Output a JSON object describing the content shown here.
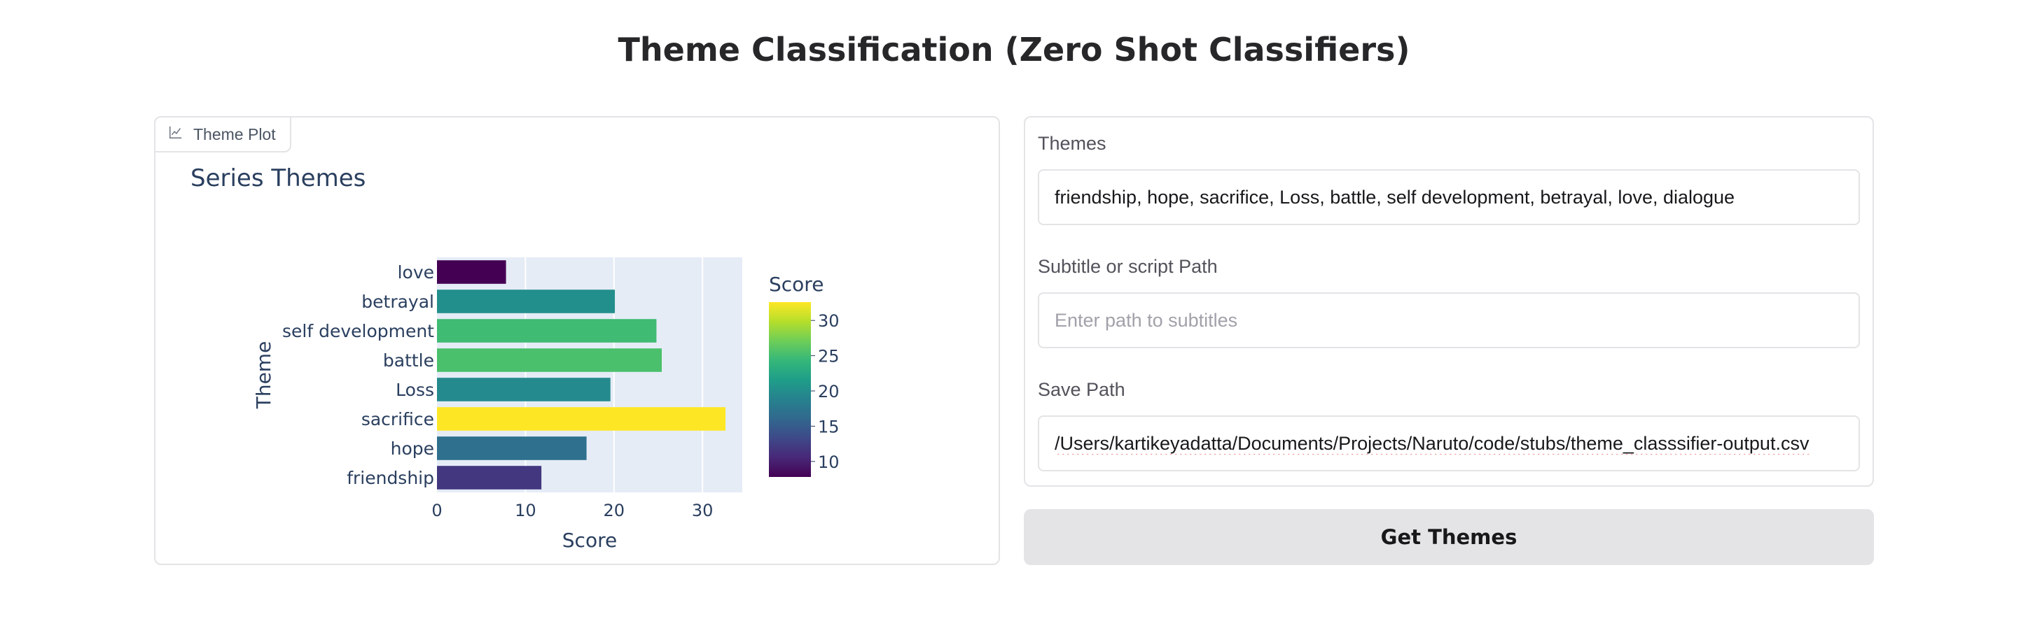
{
  "page": {
    "title": "Theme Classification (Zero Shot Classifiers)"
  },
  "plot_panel": {
    "label": "Theme Plot",
    "icon": "chart-icon"
  },
  "form": {
    "themes": {
      "label": "Themes",
      "value": "friendship, hope, sacrifice, Loss, battle, self development, betrayal, love, dialogue"
    },
    "subtitle_path": {
      "label": "Subtitle or script Path",
      "value": "",
      "placeholder": "Enter path to subtitles"
    },
    "save_path": {
      "label": "Save Path",
      "value": "/Users/kartikeyadatta/Documents/Projects/Naruto/code/stubs/theme_classsifier-output.csv"
    },
    "submit_label": "Get Themes"
  },
  "chart_data": {
    "type": "bar",
    "orientation": "horizontal",
    "title": "Series Themes",
    "xlabel": "Score",
    "ylabel": "Theme",
    "categories": [
      "friendship",
      "hope",
      "sacrifice",
      "Loss",
      "battle",
      "self development",
      "betrayal",
      "love"
    ],
    "values": [
      11.8,
      16.9,
      32.6,
      19.6,
      25.4,
      24.8,
      20.1,
      7.8
    ],
    "xlim": [
      0,
      34.5
    ],
    "xticks": [
      0,
      10,
      20,
      30
    ],
    "grid": true,
    "colorbar": {
      "title": "Score",
      "colorscale": "viridis",
      "range": [
        7.8,
        32.6
      ],
      "ticks": [
        10,
        15,
        20,
        25,
        30
      ]
    },
    "colors": {
      "plot_bg": "#e5ecf6",
      "text": "#2a3f5f"
    }
  }
}
